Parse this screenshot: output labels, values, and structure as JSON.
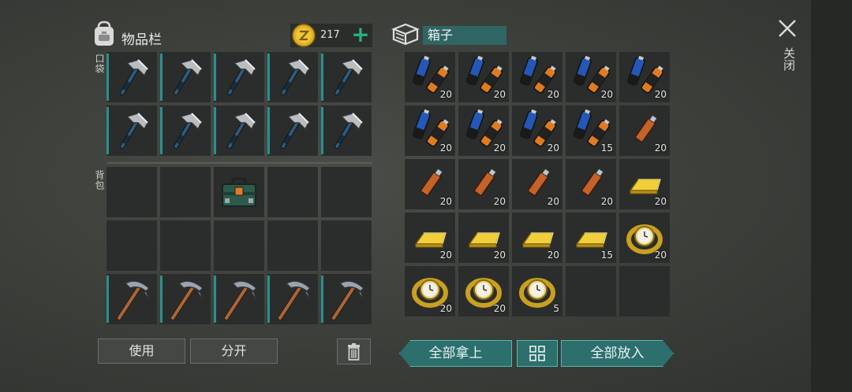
{
  "inventory": {
    "title": "物品栏",
    "coins": "217",
    "plus": "+",
    "pocket_label": "口袋",
    "backpack_label": "背包",
    "pocket_items": [
      "hatchet",
      "hatchet",
      "hatchet",
      "hatchet",
      "hatchet",
      "hatchet",
      "hatchet",
      "hatchet",
      "hatchet",
      "hatchet"
    ],
    "backpack_items": [
      "empty",
      "empty",
      "toolbox",
      "empty",
      "empty",
      "empty",
      "empty",
      "empty",
      "empty",
      "empty",
      "pickaxe",
      "pickaxe",
      "pickaxe",
      "pickaxe",
      "pickaxe"
    ]
  },
  "buttons": {
    "use": "使用",
    "split": "分开",
    "take_all": "全部拿上",
    "put_all": "全部放入",
    "grid_icon": "田"
  },
  "box": {
    "title": "箱子",
    "items": [
      {
        "type": "battery",
        "qty": "20"
      },
      {
        "type": "battery",
        "qty": "20"
      },
      {
        "type": "battery",
        "qty": "20"
      },
      {
        "type": "battery",
        "qty": "20"
      },
      {
        "type": "battery",
        "qty": "20"
      },
      {
        "type": "battery",
        "qty": "20"
      },
      {
        "type": "battery",
        "qty": "20"
      },
      {
        "type": "battery",
        "qty": "20"
      },
      {
        "type": "battery",
        "qty": "15"
      },
      {
        "type": "usb",
        "qty": "20"
      },
      {
        "type": "usb",
        "qty": "20"
      },
      {
        "type": "usb",
        "qty": "20"
      },
      {
        "type": "usb",
        "qty": "20"
      },
      {
        "type": "usb",
        "qty": "20"
      },
      {
        "type": "gold",
        "qty": "20"
      },
      {
        "type": "gold",
        "qty": "20"
      },
      {
        "type": "gold",
        "qty": "20"
      },
      {
        "type": "gold",
        "qty": "20"
      },
      {
        "type": "gold",
        "qty": "15"
      },
      {
        "type": "watch",
        "qty": "20"
      },
      {
        "type": "watch",
        "qty": "20"
      },
      {
        "type": "watch",
        "qty": "20"
      },
      {
        "type": "watch",
        "qty": "5"
      },
      {
        "type": "empty",
        "qty": ""
      },
      {
        "type": "empty",
        "qty": ""
      }
    ]
  },
  "close": {
    "label": "关闭"
  },
  "colors": {
    "accent": "#2c6f6c",
    "plus": "#27b37c",
    "coin": "#e0b020"
  }
}
